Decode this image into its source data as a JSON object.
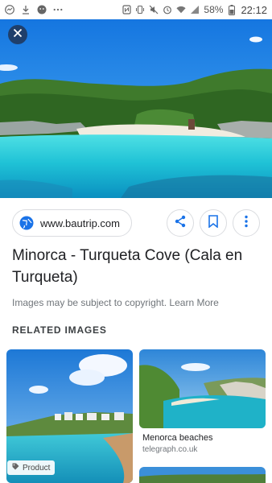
{
  "status_bar": {
    "battery_percent": "58%",
    "time": "22:12",
    "left_icons": [
      "messenger-icon",
      "download-icon",
      "smiley-icon",
      "more-dots-icon"
    ],
    "right_icons": [
      "nfc-icon",
      "vibrate-icon",
      "mute-icon",
      "alarm-icon",
      "wifi-icon",
      "signal-icon",
      "battery-icon"
    ]
  },
  "viewer": {
    "source_domain": "www.bautrip.com",
    "title": "Minorca - Turqueta Cove (Cala en Turqueta)",
    "copyright_notice": "Images may be subject to copyright. Learn More",
    "actions": [
      "share-icon",
      "bookmark-icon",
      "more-vert-icon"
    ]
  },
  "related": {
    "heading": "RELATED IMAGES",
    "items": [
      {
        "badge": "Product",
        "label": "",
        "source": ""
      },
      {
        "label": "Menorca beaches",
        "source": "telegraph.co.uk"
      }
    ]
  },
  "colors": {
    "sea": "#1fc2d6",
    "sky": "#1e8fe8",
    "close_button": "#1f3f6b",
    "accent_blue": "#1a73e8"
  }
}
